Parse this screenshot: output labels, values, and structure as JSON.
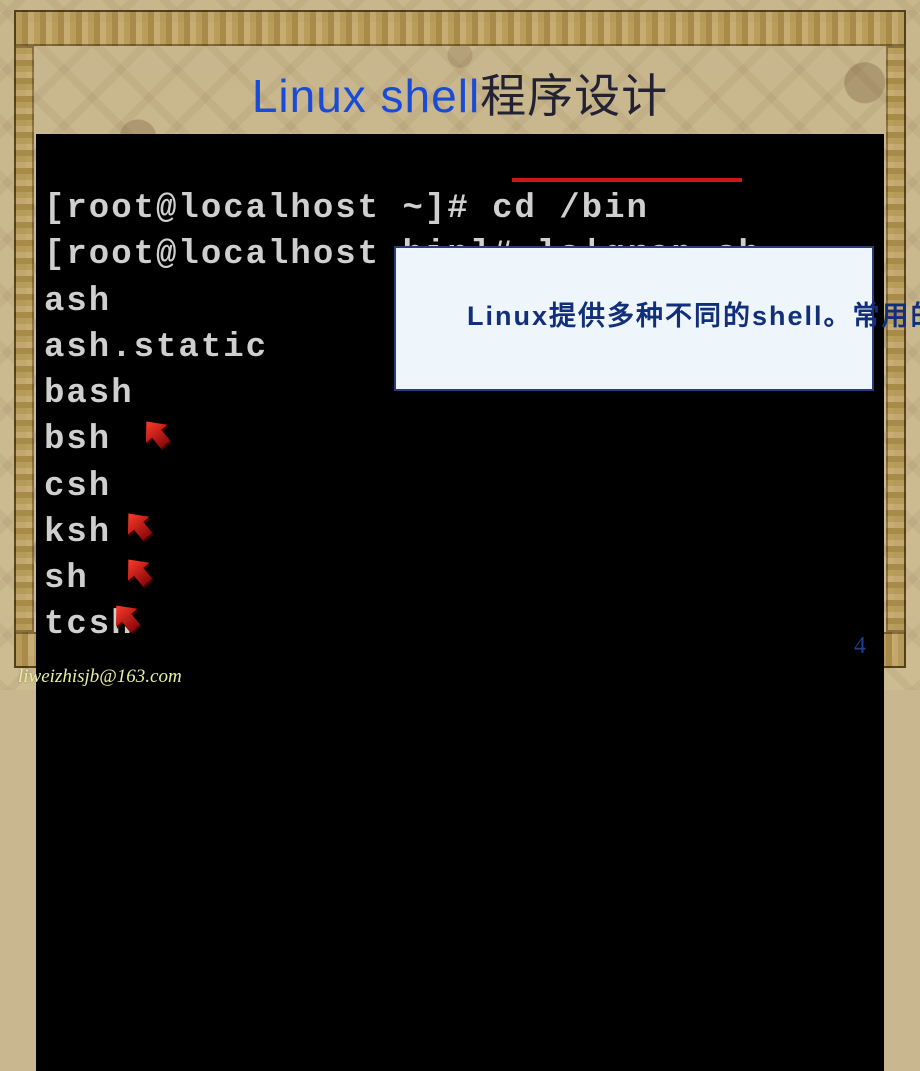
{
  "title": {
    "latin": "Linux shell",
    "cjk": "程序设计"
  },
  "terminal": {
    "lines": [
      "[root@localhost ~]# cd /bin",
      "[root@localhost bin]# ls|grep sh",
      "ash",
      "ash.static",
      "bash",
      "bsh",
      "csh",
      "ksh",
      "sh",
      "tcsh"
    ],
    "highlighted_command": "cd /bin",
    "arrows_on": [
      "bash",
      "csh",
      "ksh",
      "sh"
    ]
  },
  "callout": {
    "text": "Linux提供多种不同的shell。常用的有Bourne shell(简称sh)、C-shell(简称csh)、Korn shell(简称ksh)和Bourne Again shell(简称bash)。"
  },
  "page_number": "4",
  "footer_email": "liweizhisjb@163.com"
}
